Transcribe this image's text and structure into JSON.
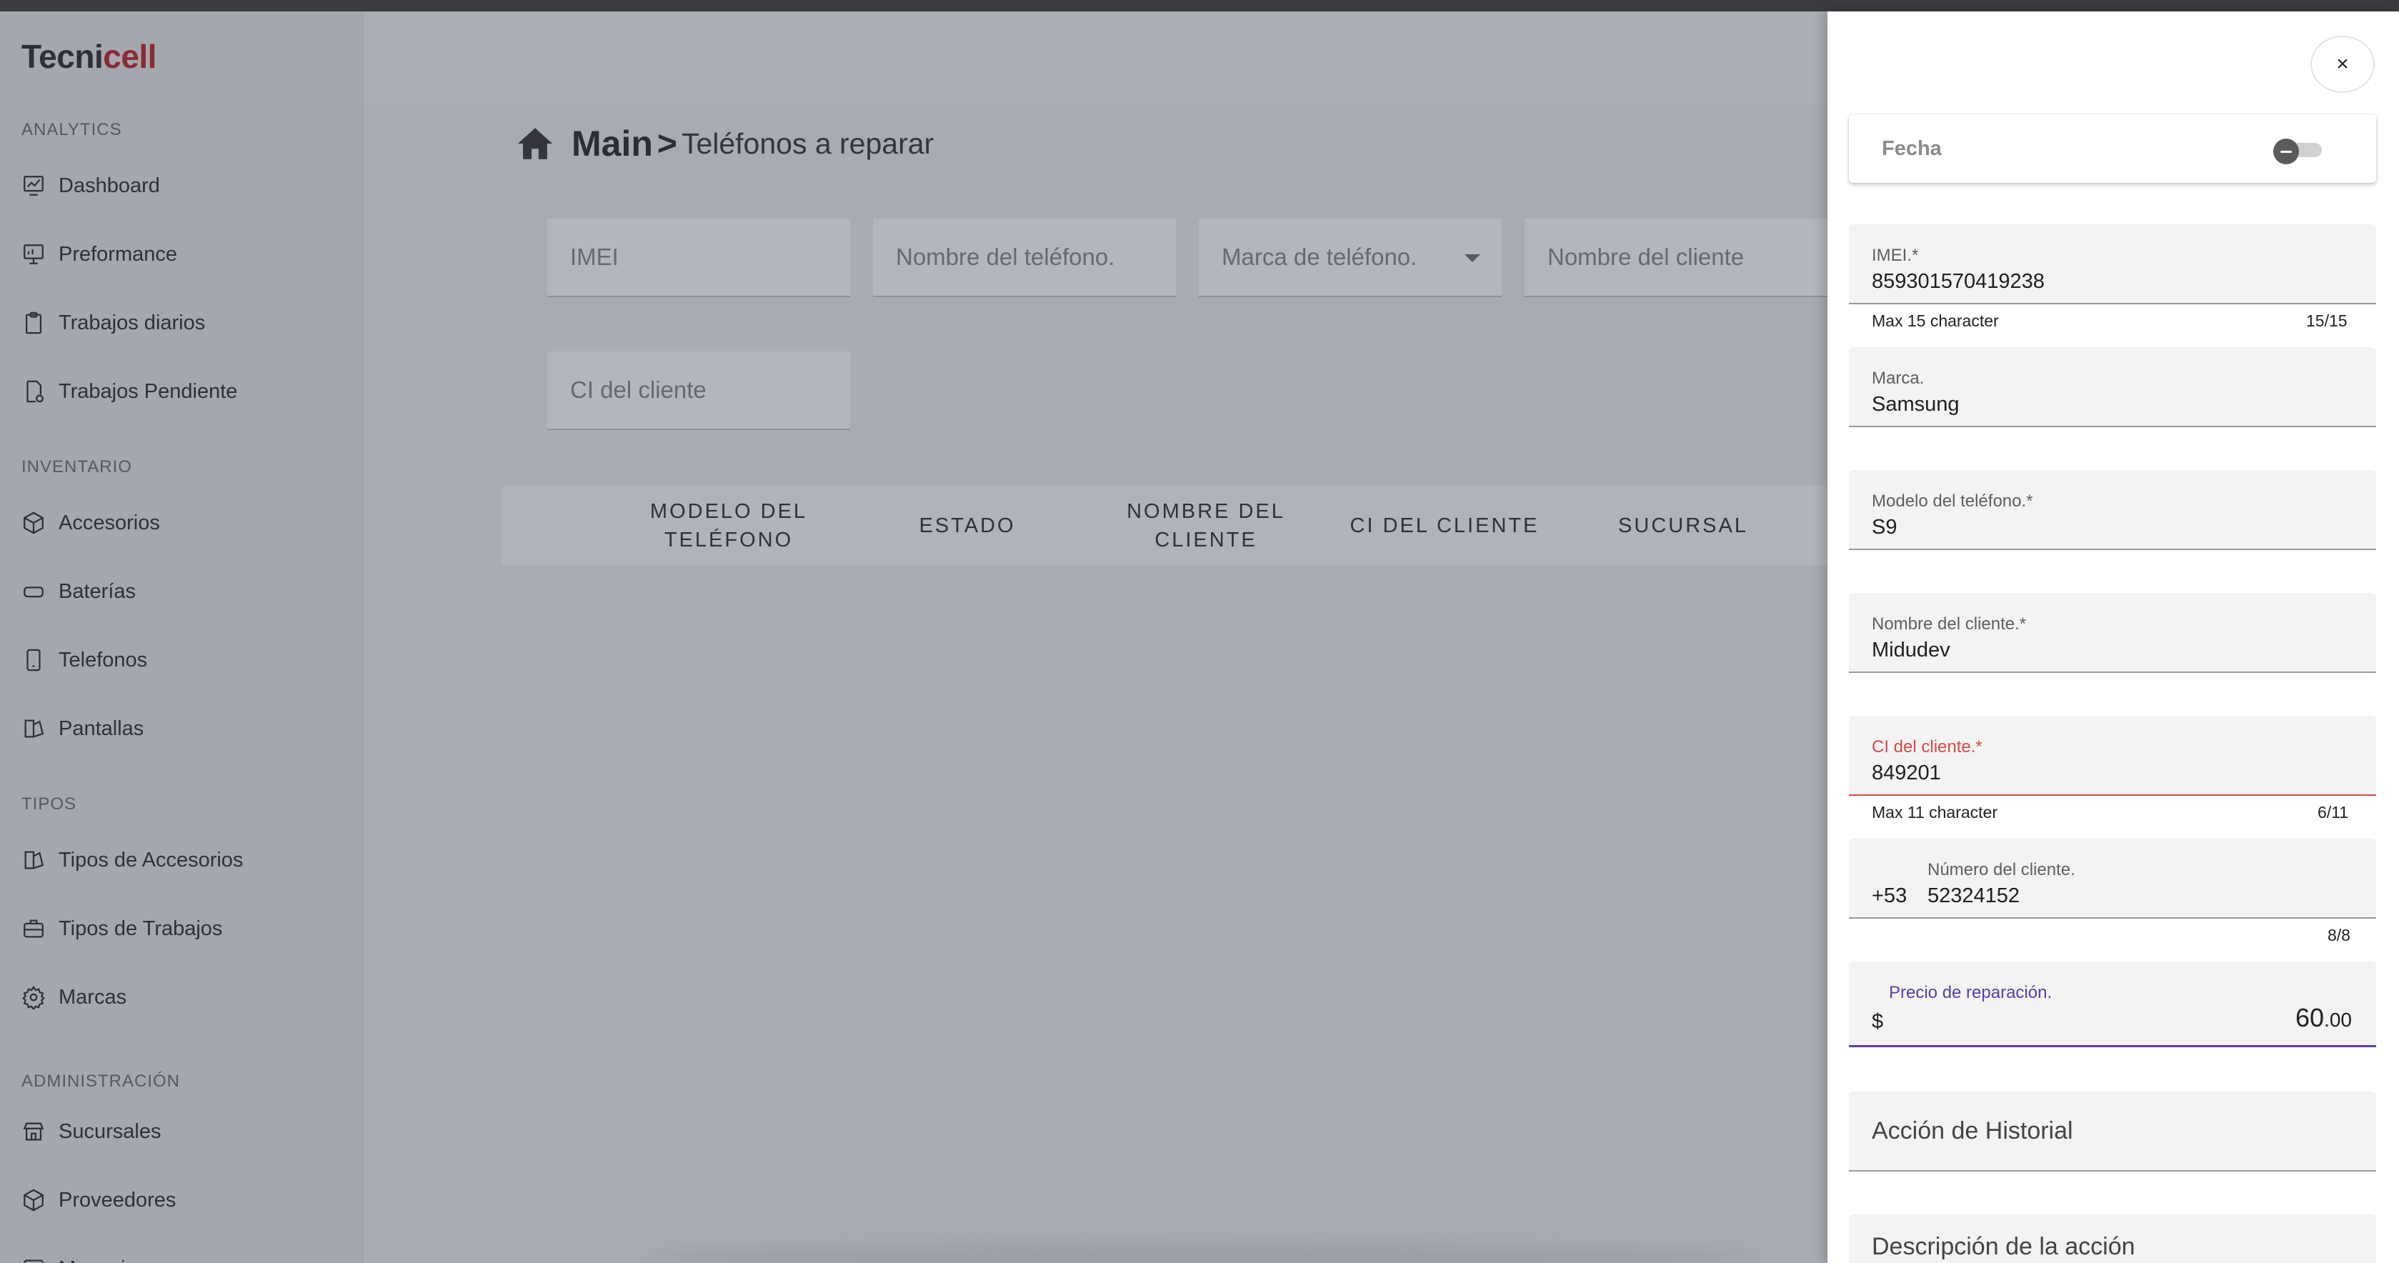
{
  "brand": {
    "part1": "Tecni",
    "part2": "cell"
  },
  "sidebar": {
    "sections": [
      {
        "title": "ANALYTICS",
        "items": [
          {
            "label": "Dashboard",
            "icon": "chart-icon"
          },
          {
            "label": "Preformance",
            "icon": "presentation-icon"
          },
          {
            "label": "Trabajos diarios",
            "icon": "clipboard-icon"
          },
          {
            "label": "Trabajos Pendiente",
            "icon": "pending-doc-icon"
          }
        ]
      },
      {
        "title": "INVENTARIO",
        "items": [
          {
            "label": "Accesorios",
            "icon": "box-icon"
          },
          {
            "label": "Baterías",
            "icon": "battery-icon"
          },
          {
            "label": "Telefonos",
            "icon": "phone-icon"
          },
          {
            "label": "Pantallas",
            "icon": "screen-icon"
          }
        ]
      },
      {
        "title": "TIPOS",
        "items": [
          {
            "label": "Tipos de Accesorios",
            "icon": "accessory-type-icon"
          },
          {
            "label": "Tipos de Trabajos",
            "icon": "briefcase-icon"
          },
          {
            "label": "Marcas",
            "icon": "gear-icon"
          }
        ]
      },
      {
        "title": "ADMINISTRACIÓN",
        "items": [
          {
            "label": "Sucursales",
            "icon": "store-icon"
          },
          {
            "label": "Proveedores",
            "icon": "supplier-box-icon"
          },
          {
            "label": "Mensajes",
            "icon": "message-icon"
          }
        ]
      }
    ]
  },
  "breadcrumb": {
    "home_icon": "home-icon",
    "main": "Main",
    "separator": ">",
    "page": "Teléfonos a reparar"
  },
  "filters": {
    "imei": "IMEI",
    "phone_name": "Nombre del teléfono.",
    "phone_brand": "Marca de teléfono.",
    "client_name": "Nombre del cliente",
    "client_ci": "CI del cliente"
  },
  "table": {
    "headers": [
      {
        "line1": "MODELO DEL",
        "line2": "TELÉFONO"
      },
      {
        "line1": "ESTADO",
        "line2": ""
      },
      {
        "line1": "NOMBRE DEL",
        "line2": "CLIENTE"
      },
      {
        "line1": "CI DEL CLIENTE",
        "line2": ""
      },
      {
        "line1": "SUCURSAL",
        "line2": ""
      }
    ]
  },
  "drawer": {
    "close": "×",
    "date_label": "Fecha",
    "date_toggle_on": false,
    "imei": {
      "label": "IMEI.*",
      "value": "859301570419238",
      "helper": "Max 15 character",
      "counter": "15/15"
    },
    "brand": {
      "label": "Marca.",
      "value": "Samsung"
    },
    "model": {
      "label": "Modelo del teléfono.*",
      "value": "S9"
    },
    "client_name": {
      "label": "Nombre del cliente.*",
      "value": "Midudev"
    },
    "client_ci": {
      "label": "CI del cliente.*",
      "value": "849201",
      "helper": "Max 11 character",
      "counter": "6/11"
    },
    "client_phone": {
      "label": "Número del cliente.",
      "prefix": "+53",
      "value": "52324152",
      "counter": "8/8"
    },
    "price": {
      "label": "Precio de reparación.",
      "prefix": "$",
      "value": "60",
      "decimals": ".00"
    },
    "history_action": {
      "placeholder": "Acción de Historial"
    },
    "action_description": {
      "placeholder": "Descripción de la acción"
    }
  },
  "colors": {
    "brand_red": "#8a2b33",
    "error": "#d84a44",
    "focus": "#5a3ea6"
  }
}
